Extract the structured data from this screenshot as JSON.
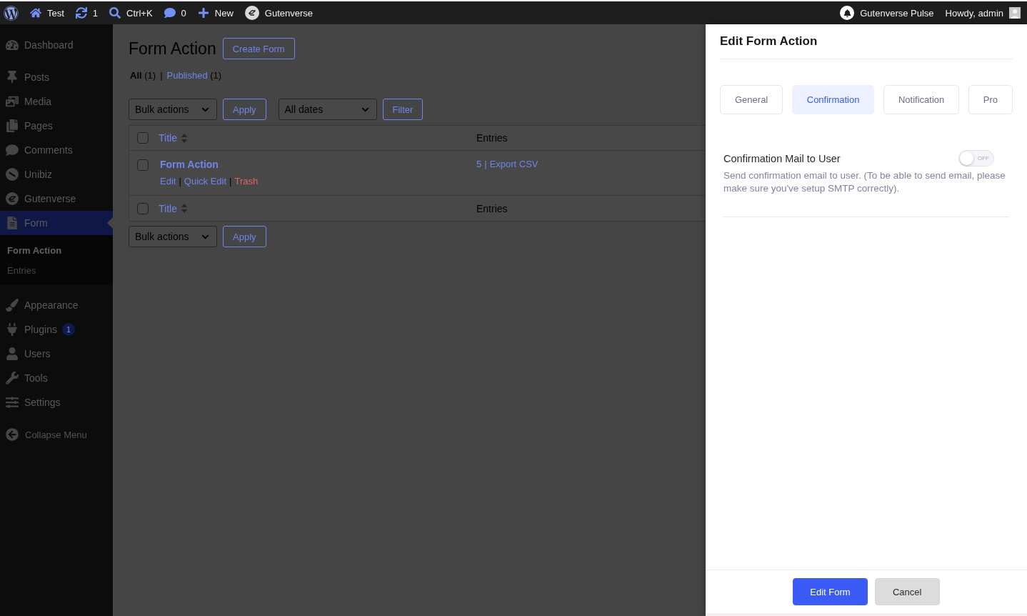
{
  "admin_bar": {
    "items": [
      {
        "label": "Test"
      },
      {
        "label": "1"
      },
      {
        "label": "Ctrl+K"
      },
      {
        "label": "0"
      },
      {
        "label": "New"
      },
      {
        "label": "Gutenverse"
      }
    ],
    "right_items": [
      {
        "label": "Gutenverse Pulse"
      },
      {
        "label": "Howdy, admin"
      }
    ]
  },
  "sidebar": {
    "groups": [
      {
        "items": [
          {
            "label": "Dashboard",
            "selected": false
          }
        ]
      },
      {
        "items": [
          {
            "label": "Posts",
            "selected": false
          },
          {
            "label": "Media",
            "selected": false
          },
          {
            "label": "Pages",
            "selected": false
          },
          {
            "label": "Comments",
            "selected": false
          },
          {
            "label": "Unibiz",
            "selected": false
          },
          {
            "label": "Gutenverse",
            "selected": false
          },
          {
            "label": "Form",
            "selected": true,
            "children": [
              {
                "label": "Form Action",
                "selected": true
              },
              {
                "label": "Entries",
                "selected": false
              }
            ]
          }
        ]
      },
      {
        "items": [
          {
            "label": "Appearance",
            "selected": false
          },
          {
            "label": "Plugins",
            "selected": false,
            "badge": "1"
          },
          {
            "label": "Users",
            "selected": false
          },
          {
            "label": "Tools",
            "selected": false
          },
          {
            "label": "Settings",
            "selected": false
          }
        ]
      }
    ],
    "collapse": "Collapse Menu"
  },
  "page": {
    "title": "Form Action",
    "create_button": "Create Form",
    "views": [
      {
        "label": "All",
        "count": "(1)",
        "selected": true
      },
      {
        "label": "Published",
        "count": "(1)",
        "selected": false
      }
    ],
    "view_separator": "|",
    "top_nav": {
      "bulk_select": "Bulk actions",
      "apply": "Apply",
      "date_select": "All dates",
      "filter": "Filter"
    },
    "table": {
      "header_checked": false,
      "columns": [
        {
          "label": "Title",
          "sortable": true
        },
        {
          "label": "Entries",
          "sortable": false
        }
      ],
      "rows": [
        {
          "checked": false,
          "title": "Form Action",
          "actions": [
            {
              "label": "Edit",
              "kind": "link"
            },
            {
              "label": "Quick Edit",
              "kind": "link"
            },
            {
              "label": "Trash",
              "kind": "delete"
            }
          ],
          "actions_separator": "|",
          "entries": "5",
          "entries_separator": "|",
          "export": "Export CSV"
        }
      ],
      "footer_checked": false,
      "footer_columns": [
        {
          "label": "Title",
          "sortable": true
        },
        {
          "label": "Entries",
          "sortable": false
        }
      ]
    },
    "bottom_nav": {
      "bulk_select": "Bulk actions",
      "apply": "Apply"
    }
  },
  "panel": {
    "title": "Edit Form Action",
    "tabs": [
      {
        "label": "General",
        "selected": false
      },
      {
        "label": "Confirmation",
        "selected": true
      },
      {
        "label": "Notification",
        "selected": false
      },
      {
        "label": "Pro",
        "selected": false
      }
    ],
    "settings": [
      {
        "label": "Confirmation Mail to User",
        "on": false,
        "state_text": "OFF",
        "description": "Send confirmation email to user. (To be able to send email, please make sure you've setup SMTP correctly)."
      }
    ],
    "buttons": [
      {
        "label": "Edit Form",
        "kind": "primary"
      },
      {
        "label": "Cancel",
        "kind": "secondary"
      }
    ]
  }
}
